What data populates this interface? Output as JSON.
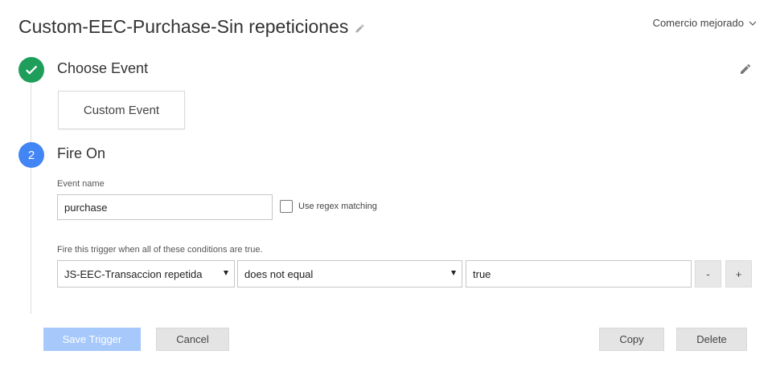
{
  "header": {
    "title": "Custom-EEC-Purchase-Sin repeticiones",
    "workspace_label": "Comercio mejorado"
  },
  "step1": {
    "title": "Choose Event",
    "event_type": "Custom Event"
  },
  "step2": {
    "number": "2",
    "title": "Fire On",
    "event_name_label": "Event name",
    "event_name_value": "purchase",
    "regex_label": "Use regex matching",
    "conditions_label": "Fire this trigger when all of these conditions are true.",
    "condition": {
      "variable": "JS-EEC-Transaccion repetida",
      "operator": "does not equal",
      "value": "true"
    },
    "remove_label": "-",
    "add_label": "+"
  },
  "footer": {
    "save_label": "Save Trigger",
    "cancel_label": "Cancel",
    "copy_label": "Copy",
    "delete_label": "Delete"
  },
  "colors": {
    "step_done": "#1e9e5a",
    "step_active": "#4285f4",
    "save_disabled": "#a6c8fb"
  }
}
